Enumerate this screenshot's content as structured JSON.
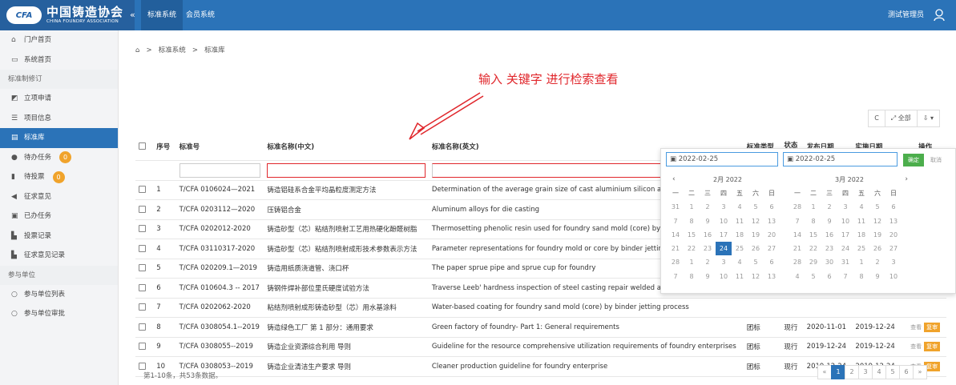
{
  "logo": {
    "badge": "CFA",
    "cn": "中国铸造协会",
    "en": "CHINA FOUNDRY ASSOCIATION"
  },
  "topbar": {
    "collapse": "«",
    "tabs": [
      "标准系统",
      "会员系统"
    ],
    "user": "测试管理员"
  },
  "sidebar": {
    "items": [
      {
        "label": "门户首页",
        "icon": "⌂"
      },
      {
        "label": "系统首页",
        "icon": "▭"
      }
    ],
    "group1": "标准制修订",
    "items2": [
      {
        "label": "立项申请",
        "icon": "◩"
      },
      {
        "label": "项目信息",
        "icon": "☰"
      },
      {
        "label": "标准库",
        "icon": "▤"
      },
      {
        "label": "待办任务",
        "icon": "●",
        "badge": "0"
      },
      {
        "label": "待投票",
        "icon": "▮",
        "badge": "0"
      },
      {
        "label": "征求意见",
        "icon": "◀"
      },
      {
        "label": "已办任务",
        "icon": "▣"
      },
      {
        "label": "投票记录",
        "icon": "▙"
      },
      {
        "label": "征求意见记录",
        "icon": "▙"
      }
    ],
    "group2": "参与单位",
    "items3": [
      {
        "label": "参与单位列表",
        "icon": "○"
      },
      {
        "label": "参与单位审批",
        "icon": "○"
      }
    ]
  },
  "breadcrumb": {
    "home": "⌂",
    "sep": ">",
    "a": "标准系统",
    "b": "标准库"
  },
  "annotation": "输入 关键字 进行检索查看",
  "toolbar": {
    "refresh": "C",
    "all": "全部",
    "export": "▾"
  },
  "table": {
    "headers": {
      "seq": "序号",
      "code": "标准号",
      "cn": "标准名称(中文)",
      "en": "标准名称(英文)",
      "type": "标准类型",
      "status": "状态",
      "pub": "发布日期",
      "impl": "实施日期",
      "ops": "操作"
    },
    "rows": [
      {
        "seq": "1",
        "code": "T/CFA 0106024—2021",
        "cn": "铸造铝硅系合金平均晶粒度测定方法",
        "en": "Determination of the average grain size of cast aluminium silicon alloys",
        "type": "",
        "status": "",
        "pub": "",
        "impl": ""
      },
      {
        "seq": "2",
        "code": "T/CFA 0203112—2020",
        "cn": "压铸铝合金",
        "en": "Aluminum alloys for die casting",
        "type": "",
        "status": "",
        "pub": "",
        "impl": ""
      },
      {
        "seq": "3",
        "code": "T/CFA 0202012-2020",
        "cn": "铸造砂型（芯）粘结剂喷射工艺用热硬化酚醛树脂",
        "en": "Thermosetting phenolic resin used for foundry sand mold (core) by binder jetting",
        "type": "",
        "status": "",
        "pub": "",
        "impl": ""
      },
      {
        "seq": "4",
        "code": "T/CFA 03110317-2020",
        "cn": "铸造砂型（芯）粘结剂喷射成形技术参数表示方法",
        "en": "Parameter representations for foundry mold or core by binder jetting",
        "type": "",
        "status": "",
        "pub": "",
        "impl": ""
      },
      {
        "seq": "5",
        "code": "T/CFA 020209.1—2019",
        "cn": "铸造用纸质浇道管、浇口杯",
        "en": "The paper sprue pipe and sprue cup for foundry",
        "type": "",
        "status": "",
        "pub": "",
        "impl": ""
      },
      {
        "seq": "6",
        "code": "T/CFA 010604.3 -- 2017",
        "cn": "铸钢件焊补部位里氏硬度试验方法",
        "en": "Traverse Leeb'  hardness inspection of steel casting repair welded areas",
        "type": "",
        "status": "",
        "pub": "",
        "impl": ""
      },
      {
        "seq": "7",
        "code": "T/CFA 0202062-2020",
        "cn": "粘结剂喷射成形铸造砂型（芯）用水基涂料",
        "en": "Water-based coating for foundry sand mold (core) by binder jetting process",
        "type": "",
        "status": "",
        "pub": "",
        "impl": ""
      },
      {
        "seq": "8",
        "code": "T/CFA 0308054.1--2019",
        "cn": "铸造绿色工厂 第 1 部分：通用要求",
        "en": "Green factory of foundry- Part 1: General requirements",
        "type": "团标",
        "status": "现行",
        "pub": "2020-11-01",
        "impl": "2019-12-24"
      },
      {
        "seq": "9",
        "code": "T/CFA 0308055--2019",
        "cn": "铸造企业资源综合利用 导则",
        "en": "Guideline for the resource comprehensive utilization requirements of foundry enterprises",
        "type": "团标",
        "status": "现行",
        "pub": "2019-12-24",
        "impl": "2019-12-24"
      },
      {
        "seq": "10",
        "code": "T/CFA 0308053--2019",
        "cn": "铸造企业清洁生产要求 导则",
        "en": "Cleaner production guideline for foundry enterprise",
        "type": "团标",
        "status": "现行",
        "pub": "2019-12-24",
        "impl": "2019-12-24"
      }
    ],
    "view_label": "查看",
    "revise_label": "复审"
  },
  "footer": "第1-10条，共53条数据。",
  "pager": [
    "«",
    "1",
    "2",
    "3",
    "4",
    "5",
    "6",
    "»"
  ],
  "datepicker": {
    "start": "2022-02-25",
    "end": "2022-02-25",
    "confirm": "确定",
    "cancel": "取消",
    "left": {
      "title": "2月 2022",
      "weekdays": [
        "一",
        "二",
        "三",
        "四",
        "五",
        "六",
        "日"
      ],
      "days": [
        "31",
        "1",
        "2",
        "3",
        "4",
        "5",
        "6",
        "7",
        "8",
        "9",
        "10",
        "11",
        "12",
        "13",
        "14",
        "15",
        "16",
        "17",
        "18",
        "19",
        "20",
        "21",
        "22",
        "23",
        "24",
        "25",
        "26",
        "27",
        "28",
        "1",
        "2",
        "3",
        "4",
        "5",
        "6",
        "7",
        "8",
        "9",
        "10",
        "11",
        "12",
        "13"
      ],
      "selected_index": 24
    },
    "right": {
      "title": "3月 2022",
      "weekdays": [
        "一",
        "二",
        "三",
        "四",
        "五",
        "六",
        "日"
      ],
      "days": [
        "28",
        "1",
        "2",
        "3",
        "4",
        "5",
        "6",
        "7",
        "8",
        "9",
        "10",
        "11",
        "12",
        "13",
        "14",
        "15",
        "16",
        "17",
        "18",
        "19",
        "20",
        "21",
        "22",
        "23",
        "24",
        "25",
        "26",
        "27",
        "28",
        "29",
        "30",
        "31",
        "1",
        "2",
        "3",
        "4",
        "5",
        "6",
        "7",
        "8",
        "9",
        "10"
      ]
    }
  },
  "colors": {
    "brand": "#2b73b8",
    "accent": "#f0a32b",
    "annotation": "#e0262b",
    "confirm": "#4cae4c"
  }
}
